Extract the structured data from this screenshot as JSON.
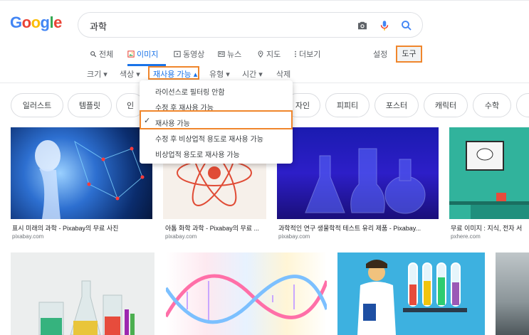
{
  "logo": {
    "letters": [
      "G",
      "o",
      "o",
      "g",
      "l",
      "e"
    ],
    "colors": [
      "#4285f4",
      "#ea4335",
      "#fbbc05",
      "#4285f4",
      "#34a853",
      "#ea4335"
    ]
  },
  "search": {
    "query": "과학"
  },
  "tabs": [
    {
      "label": "전체",
      "icon": "search-icon"
    },
    {
      "label": "이미지",
      "icon": "image-icon",
      "active": true
    },
    {
      "label": "동영상",
      "icon": "play-icon"
    },
    {
      "label": "뉴스",
      "icon": "news-icon"
    },
    {
      "label": "지도",
      "icon": "map-pin-icon"
    },
    {
      "label": "더보기",
      "icon": "more-dots-icon"
    }
  ],
  "settings_label": "설정",
  "tools_label": "도구",
  "filters": {
    "size": "크기",
    "color": "색상",
    "usage_rights": "재사용 가능",
    "type": "유형",
    "time": "시간",
    "clear": "삭제"
  },
  "chips": [
    "일러스트",
    "템플릿",
    "인",
    "자인",
    "피피티",
    "포스터",
    "캐릭터",
    "수학"
  ],
  "dropdown": {
    "items": [
      "라이선스로 필터링 안함",
      "수정 후 재사용 가능",
      "재사용 가능",
      "수정 후 비상업적 용도로 재사용 가능",
      "비상업적 용도로 재사용 가능"
    ],
    "checked": "✓"
  },
  "results": [
    {
      "caption": "표시 미래의 과학 - Pixabay의 무료 사진",
      "source": "pixabay.com"
    },
    {
      "caption": "아톰 화학 과학 - Pixabay의 무료 ...",
      "source": "pixabay.com"
    },
    {
      "caption": "과학적인 연구 생물학적 테스트 유리 제품 - Pixabay...",
      "source": "pixabay.com"
    },
    {
      "caption": "무료 이미지 : 지식, 전자 서",
      "source": "pxhere.com"
    }
  ],
  "colors": {
    "accent": "#1a73e8",
    "highlight": "#f0862c"
  }
}
